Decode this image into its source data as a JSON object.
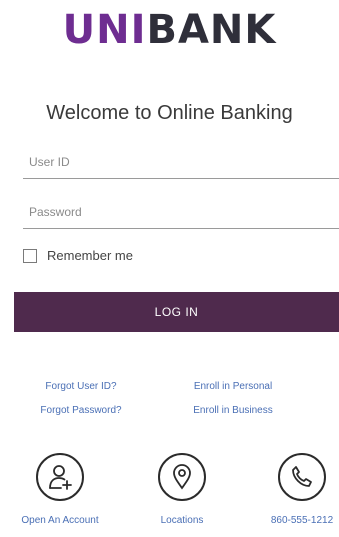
{
  "brand": {
    "part1": "UNI",
    "part2": "BANK",
    "color_primary": "#6e2d91",
    "color_secondary": "#2f2f3a"
  },
  "login": {
    "welcome": "Welcome to Online Banking",
    "user_id_placeholder": "User ID",
    "password_placeholder": "Password",
    "remember_label": "Remember me",
    "remember_checked": false,
    "button_label": "LOG IN",
    "button_color": "#4f2a4d"
  },
  "links": {
    "forgot_user": "Forgot User ID?",
    "forgot_password": "Forgot Password?",
    "enroll_personal": "Enroll in Personal",
    "enroll_business": "Enroll in Business",
    "color": "#4a6fb5"
  },
  "bottom_nav": [
    {
      "label": "Open An Account",
      "icon": "add-user-icon"
    },
    {
      "label": "Locations",
      "icon": "map-pin-icon"
    },
    {
      "label": "860-555-1212",
      "icon": "phone-icon"
    }
  ]
}
